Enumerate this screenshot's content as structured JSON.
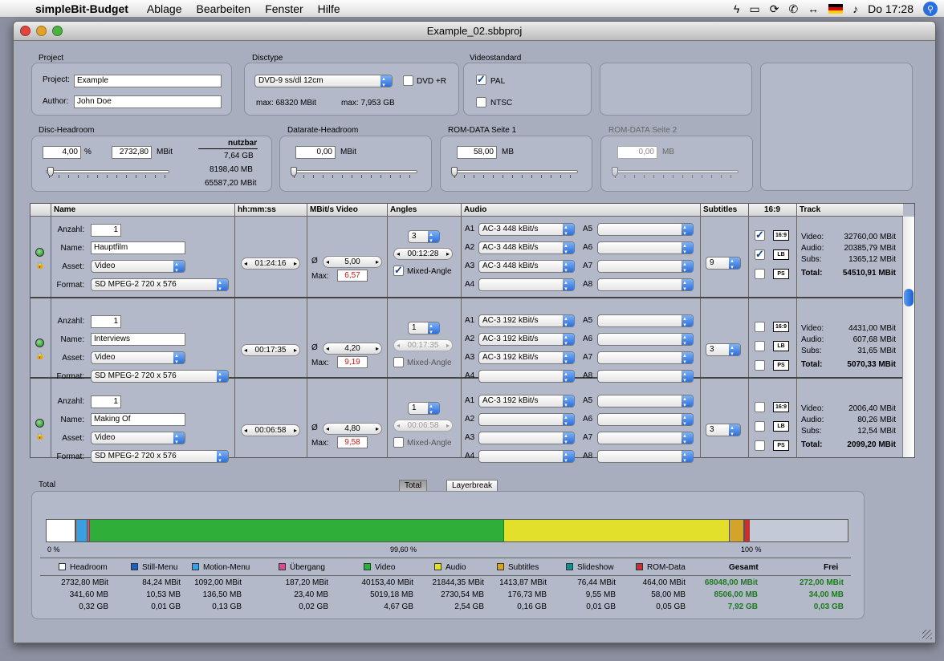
{
  "menubar": {
    "app_name": "simpleBit-Budget",
    "items": [
      "Ablage",
      "Bearbeiten",
      "Fenster",
      "Hilfe"
    ],
    "clock": "Do 17:28"
  },
  "window": {
    "title": "Example_02.sbbproj"
  },
  "project": {
    "label": "Project",
    "project_label": "Project:",
    "project_value": "Example",
    "author_label": "Author:",
    "author_value": "John Doe"
  },
  "disctype": {
    "label": "Disctype",
    "select": "DVD-9     ss/dl      12cm",
    "dvdr_label": "DVD +R",
    "max_mbit": "max: 68320 MBit",
    "max_gb": "max: 7,953 GB"
  },
  "videostandard": {
    "label": "Videostandard",
    "pal": "PAL",
    "ntsc": "NTSC"
  },
  "disc_headroom": {
    "label": "Disc-Headroom",
    "percent_value": "4,00",
    "percent_unit": "%",
    "mbit_value": "2732,80",
    "mbit_unit": "MBit",
    "nutzbar_label": "nutzbar",
    "nutzbar_gb": "7,64 GB",
    "nutzbar_mb": "8198,40 MB",
    "nutzbar_mbit": "65587,20 MBit"
  },
  "datarate_headroom": {
    "label": "Datarate-Headroom",
    "value": "0,00",
    "unit": "MBit"
  },
  "rom1": {
    "label": "ROM-DATA Seite 1",
    "value": "58,00",
    "unit": "MB"
  },
  "rom2": {
    "label": "ROM-DATA Seite 2",
    "value": "0,00",
    "unit": "MB"
  },
  "table_headers": {
    "name": "Name",
    "time": "hh:mm:ss",
    "mbit": "MBit/s Video",
    "angles": "Angles",
    "audio": "Audio",
    "subtitles": "Subtitles",
    "aspect": "16:9",
    "track": "Track"
  },
  "row_labels": {
    "anzahl": "Anzahl:",
    "name": "Name:",
    "asset": "Asset:",
    "format": "Format:",
    "avg": "Ø",
    "max": "Max:",
    "mixed": "Mixed-Angle",
    "video": "Video:",
    "audio": "Audio:",
    "subs": "Subs:",
    "total": "Total:",
    "a16": "16:9",
    "lb": "LB",
    "ps": "PS"
  },
  "rows": [
    {
      "anzahl": "1",
      "name": "Hauptfilm",
      "asset": "Video",
      "format": "SD MPEG-2 720 x 576",
      "time": "01:24:16",
      "avg": "5,00",
      "max": "6,57",
      "angles": "3",
      "angle_time": "00:12:28",
      "a1": "AC-3  448 kBit/s",
      "a2": "AC-3  448 kBit/s",
      "a3": "AC-3  448 kBit/s",
      "subtitles": "9",
      "video": "32760,00 MBit",
      "audio": "20385,79 MBit",
      "subs": "1365,12 MBit",
      "total": "54510,91 MBit"
    },
    {
      "anzahl": "1",
      "name": "Interviews",
      "asset": "Video",
      "format": "SD MPEG-2 720 x 576",
      "time": "00:17:35",
      "avg": "4,20",
      "max": "9,19",
      "angles": "1",
      "angle_time": "00:17:35",
      "a1": "AC-3  192 kBit/s",
      "a2": "AC-3  192 kBit/s",
      "a3": "AC-3  192 kBit/s",
      "subtitles": "3",
      "video": "4431,00 MBit",
      "audio": "607,68 MBit",
      "subs": "31,65 MBit",
      "total": "5070,33 MBit"
    },
    {
      "anzahl": "1",
      "name": "Making Of",
      "asset": "Video",
      "format": "SD MPEG-2 720 x 576",
      "time": "00:06:58",
      "avg": "4,80",
      "max": "9,58",
      "angles": "1",
      "angle_time": "00:06:58",
      "a1": "AC-3  192 kBit/s",
      "a2": "",
      "a3": "",
      "subtitles": "3",
      "video": "2006,40 MBit",
      "audio": "80,26 MBit",
      "subs": "12,54 MBit",
      "total": "2099,20 MBit"
    }
  ],
  "total": {
    "label": "Total",
    "tab_total": "Total",
    "tab_layer": "Layerbreak",
    "pct_0": "0 %",
    "pct_mid": "99,60 %",
    "pct_100": "100 %",
    "legend": [
      {
        "name": "Headroom",
        "color": "#ffffff",
        "mbit": "2732,80 MBit",
        "mb": "341,60 MB",
        "gb": "0,32 GB"
      },
      {
        "name": "Still-Menu",
        "color": "#1f5fb8",
        "mbit": "84,24 MBit",
        "mb": "10,53 MB",
        "gb": "0,01 GB"
      },
      {
        "name": "Motion-Menu",
        "color": "#3b9ee0",
        "mbit": "1092,00 MBit",
        "mb": "136,50 MB",
        "gb": "0,13 GB"
      },
      {
        "name": "Übergang",
        "color": "#d0508a",
        "mbit": "187,20 MBit",
        "mb": "23,40 MB",
        "gb": "0,02 GB"
      },
      {
        "name": "Video",
        "color": "#2fae3a",
        "mbit": "40153,40 MBit",
        "mb": "5019,18 MB",
        "gb": "4,67 GB"
      },
      {
        "name": "Audio",
        "color": "#e2e02a",
        "mbit": "21844,35 MBit",
        "mb": "2730,54 MB",
        "gb": "2,54 GB"
      },
      {
        "name": "Subtitles",
        "color": "#d4a42a",
        "mbit": "1413,87 MBit",
        "mb": "176,73 MB",
        "gb": "0,16 GB"
      },
      {
        "name": "Slideshow",
        "color": "#1a8a8a",
        "mbit": "76,44 MBit",
        "mb": "9,55 MB",
        "gb": "0,01 GB"
      },
      {
        "name": "ROM-Data",
        "color": "#c83030",
        "mbit": "464,00 MBit",
        "mb": "58,00 MB",
        "gb": "0,05 GB"
      }
    ],
    "gesamt_label": "Gesamt",
    "gesamt_mbit": "68048,00 MBit",
    "gesamt_mb": "8506,00 MB",
    "gesamt_gb": "7,92 GB",
    "frei_label": "Frei",
    "frei_mbit": "272,00 MBit",
    "frei_mb": "34,00 MB",
    "frei_gb": "0,03 GB"
  }
}
